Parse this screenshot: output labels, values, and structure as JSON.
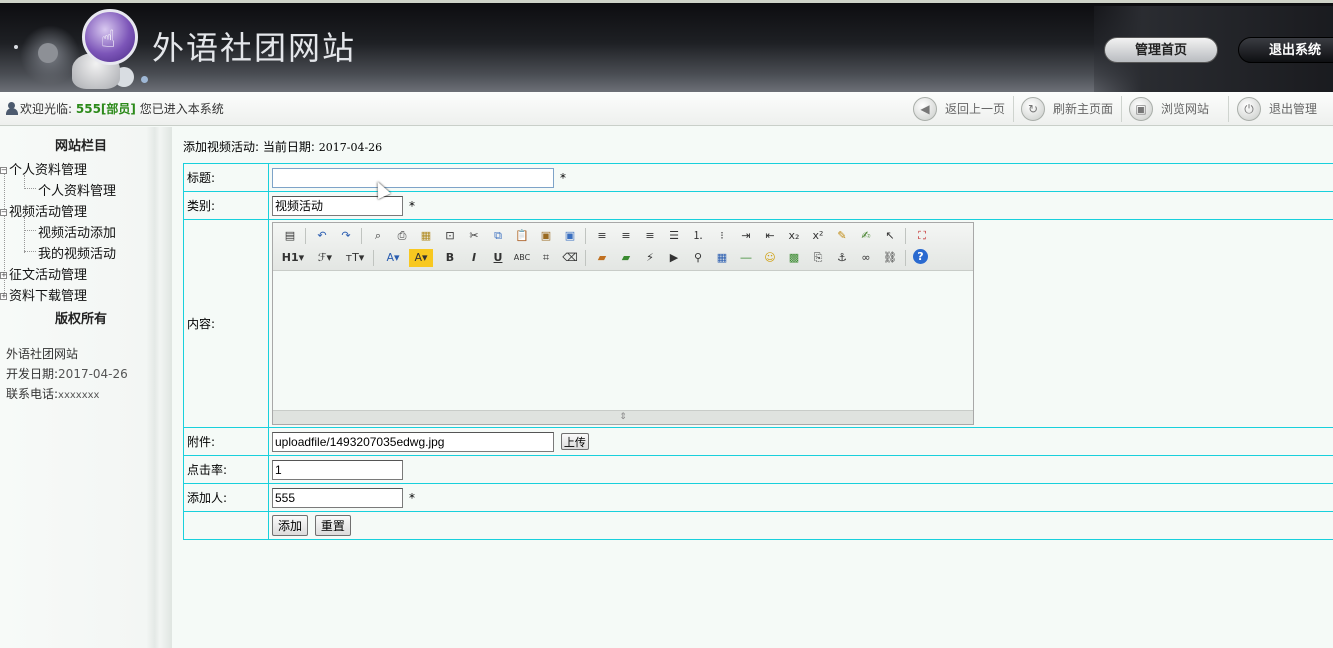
{
  "header": {
    "site_title": "外语社团网站",
    "buttons": [
      {
        "label": "管理首页"
      },
      {
        "label": "退出系统"
      }
    ],
    "colors": {
      "bar_top": "#0d0d10",
      "logo_purple": "#7c55b8"
    }
  },
  "topbar": {
    "welcome_prefix": "欢迎光临:",
    "user": "555[部员]",
    "welcome_suffix": "您已进入本系统",
    "nav": [
      {
        "icon": "back-arrow-icon",
        "label": "返回上一页"
      },
      {
        "icon": "refresh-icon",
        "label": "刷新主页面"
      },
      {
        "icon": "browse-icon",
        "label": "浏览网站"
      },
      {
        "icon": "power-icon",
        "label": "退出管理"
      }
    ]
  },
  "sidebar": {
    "title": "网站栏目",
    "tree": [
      {
        "label": "个人资料管理",
        "expanded": true,
        "children": [
          "个人资料管理"
        ]
      },
      {
        "label": "视频活动管理",
        "expanded": true,
        "children": [
          "视频活动添加",
          "我的视频活动"
        ]
      },
      {
        "label": "征文活动管理",
        "expanded": false,
        "children": []
      },
      {
        "label": "资料下载管理",
        "expanded": false,
        "children": []
      }
    ],
    "copyright_title": "版权所有",
    "info": {
      "site_name": "外语社团网站",
      "dev_date_label": "开发日期:",
      "dev_date": "2017-04-26",
      "phone_label": "联系电话:",
      "phone": "xxxxxxx"
    }
  },
  "main": {
    "page_title": "添加视频活动:",
    "date_label": "当前日期:",
    "date": "2017-04-26",
    "form": {
      "title_label": "标题:",
      "title_value": "",
      "category_label": "类别:",
      "category_value": "视频活动",
      "content_label": "内容:",
      "attachment_label": "附件:",
      "attachment_value": "uploadfile/1493207035edwg.jpg",
      "upload_button": "上传",
      "clicks_label": "点击率:",
      "clicks_value": "1",
      "adder_label": "添加人:",
      "adder_value": "555",
      "required_mark": "*",
      "submit_button": "添加",
      "reset_button": "重置"
    },
    "editor_toolbar": {
      "row1": [
        "source-icon",
        "undo-icon",
        "redo-icon",
        "preview-icon",
        "print-icon",
        "template-icon",
        "select-all-icon",
        "cut-icon",
        "copy-icon",
        "paste-icon",
        "paste-text-icon",
        "paste-word-icon",
        "align-left-icon",
        "align-center-icon",
        "align-right-icon",
        "justify-icon",
        "ordered-list-icon",
        "unordered-list-icon",
        "indent-icon",
        "outdent-icon",
        "subscript-icon",
        "superscript-icon",
        "clear-format-icon",
        "spellcheck-icon",
        "select-icon",
        "fullscreen-icon"
      ],
      "row2": [
        "heading-icon",
        "font-family-icon",
        "font-size-icon",
        "font-color-icon",
        "highlight-icon",
        "bold-icon",
        "italic-icon",
        "underline-icon",
        "strikethrough-icon",
        "line-height-icon",
        "eraser-icon",
        "image-icon",
        "multi-image-icon",
        "flash-icon",
        "media-icon",
        "attachment-icon",
        "table-icon",
        "hr-icon",
        "emoticon-icon",
        "map-icon",
        "pagebreak-icon",
        "anchor-icon",
        "link-icon",
        "unlink-icon",
        "help-icon"
      ],
      "heading_text": "H1"
    }
  }
}
